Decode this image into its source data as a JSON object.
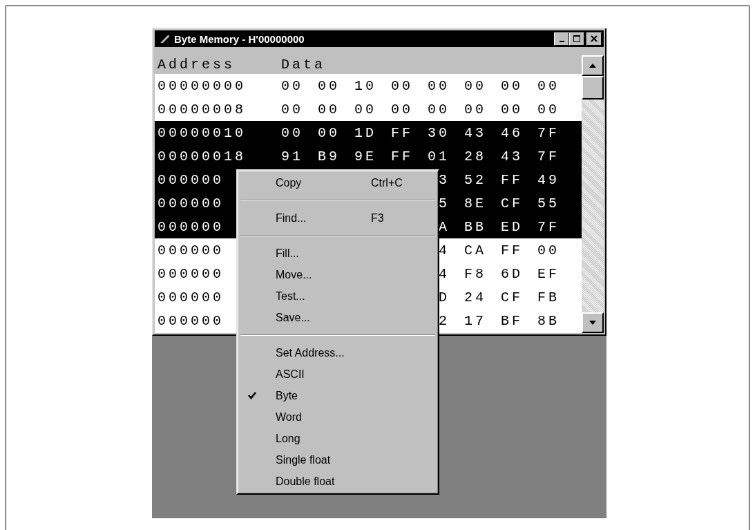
{
  "window": {
    "title": "Byte Memory - H'00000000"
  },
  "columns": [
    "Address",
    "Data"
  ],
  "rows": [
    {
      "address": "00000000",
      "cells": [
        "00",
        "00",
        "10",
        "00",
        "00",
        "00",
        "00",
        "00"
      ],
      "selected": false
    },
    {
      "address": "00000008",
      "cells": [
        "00",
        "00",
        "00",
        "00",
        "00",
        "00",
        "00",
        "00"
      ],
      "selected": false
    },
    {
      "address": "00000010",
      "cells": [
        "00",
        "00",
        "1D",
        "FF",
        "30",
        "43",
        "46",
        "7F"
      ],
      "selected": true
    },
    {
      "address": "00000018",
      "cells": [
        "91",
        "B9",
        "9E",
        "FF",
        "01",
        "28",
        "43",
        "7F"
      ],
      "selected": true
    },
    {
      "address": "000000",
      "cells": [
        "3",
        "52",
        "FF",
        "49"
      ],
      "selected": true
    },
    {
      "address": "000000",
      "cells": [
        "5",
        "8E",
        "CF",
        "55"
      ],
      "selected": true
    },
    {
      "address": "000000",
      "cells": [
        "A",
        "BB",
        "ED",
        "7F"
      ],
      "selected": true
    },
    {
      "address": "000000",
      "cells": [
        "4",
        "CA",
        "FF",
        "00"
      ],
      "selected": false
    },
    {
      "address": "000000",
      "cells": [
        "4",
        "F8",
        "6D",
        "EF"
      ],
      "selected": false
    },
    {
      "address": "000000",
      "cells": [
        "D",
        "24",
        "CF",
        "FB"
      ],
      "selected": false
    },
    {
      "address": "000000",
      "cells": [
        "2",
        "17",
        "BF",
        "8B"
      ],
      "selected": false
    }
  ],
  "context_menu": {
    "items": [
      {
        "kind": "item",
        "label": "Copy",
        "shortcut": "Ctrl+C",
        "checked": false
      },
      {
        "kind": "separator"
      },
      {
        "kind": "item",
        "label": "Find...",
        "shortcut": "F3",
        "checked": false
      },
      {
        "kind": "separator"
      },
      {
        "kind": "item",
        "label": "Fill...",
        "checked": false
      },
      {
        "kind": "item",
        "label": "Move...",
        "checked": false
      },
      {
        "kind": "item",
        "label": "Test...",
        "checked": false
      },
      {
        "kind": "item",
        "label": "Save...",
        "checked": false
      },
      {
        "kind": "separator"
      },
      {
        "kind": "item",
        "label": "Set Address...",
        "checked": false
      },
      {
        "kind": "item",
        "label": "ASCII",
        "checked": false
      },
      {
        "kind": "item",
        "label": "Byte",
        "checked": true
      },
      {
        "kind": "item",
        "label": "Word",
        "checked": false
      },
      {
        "kind": "item",
        "label": "Long",
        "checked": false
      },
      {
        "kind": "item",
        "label": "Single float",
        "checked": false
      },
      {
        "kind": "item",
        "label": "Double float",
        "checked": false
      }
    ]
  }
}
